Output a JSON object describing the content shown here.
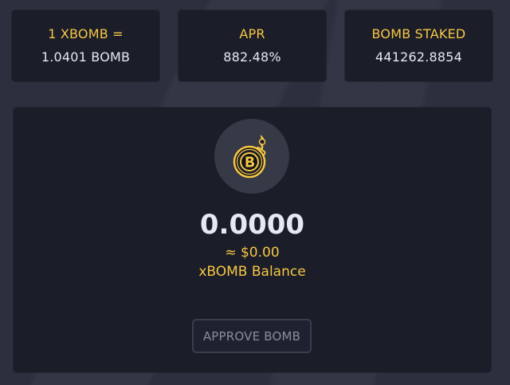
{
  "stats": {
    "ratio": {
      "label": "1 XBOMB =",
      "value": "1.0401 BOMB"
    },
    "apr": {
      "label": "APR",
      "value": "882.48%"
    },
    "staked": {
      "label": "BOMB STAKED",
      "value": "441262.8854"
    }
  },
  "main": {
    "token_icon": "bomb-token-icon",
    "balance_amount": "0.0000",
    "balance_usd": "≈ $0.00",
    "balance_label": "xBOMB Balance",
    "approve_button": {
      "label": "APPROVE BOMB",
      "disabled": true
    }
  },
  "colors": {
    "accent": "#f6c744",
    "card_background": "#1b1d29",
    "page_background": "#2c2f3e",
    "value_text": "#e6e8f5",
    "disabled_text": "#8a8d98"
  }
}
